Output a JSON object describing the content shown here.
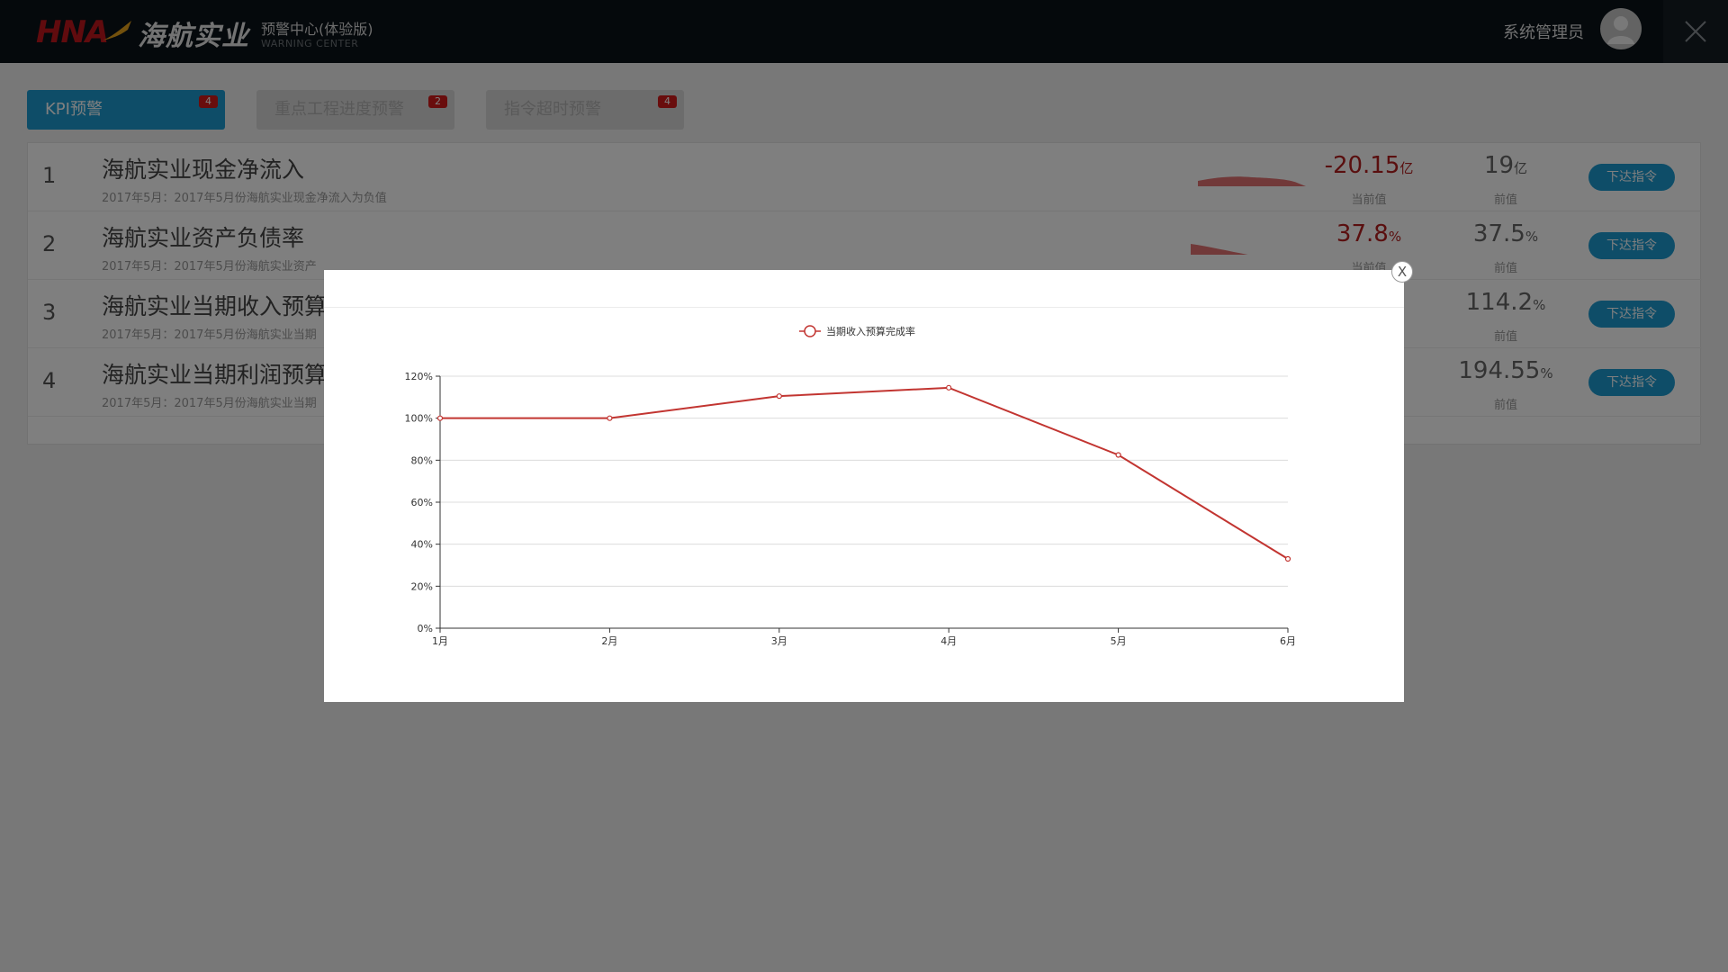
{
  "header": {
    "logo_latin": "HNA",
    "logo_cn": "海航实业",
    "app_title": "预警中心(体验版)",
    "app_subtitle": "WARNING CENTER",
    "user_name": "系统管理员",
    "avatar_icon": "user-avatar-icon",
    "close_icon": "close-x-icon"
  },
  "tabs": [
    {
      "label": "KPI预警",
      "badge": "4",
      "active": true
    },
    {
      "label": "重点工程进度预警",
      "badge": "2",
      "active": false
    },
    {
      "label": "指令超时预警",
      "badge": "4",
      "active": false
    }
  ],
  "kpi_rows": [
    {
      "index": "1",
      "title": "海航实业现金净流入",
      "desc": "2017年5月：2017年5月份海航实业现金净流入为负值",
      "current_value": "-20.15",
      "current_unit": "亿",
      "current_label": "当前值",
      "prev_value": "19",
      "prev_unit": "亿",
      "prev_label": "前值",
      "button": "下达指令"
    },
    {
      "index": "2",
      "title": "海航实业资产负债率",
      "desc": "2017年5月：2017年5月份海航实业资产",
      "current_value": "37.8",
      "current_unit": "%",
      "current_label": "当前值",
      "prev_value": "37.5",
      "prev_unit": "%",
      "prev_label": "前值",
      "button": "下达指令"
    },
    {
      "index": "3",
      "title": "海航实业当期收入预算完",
      "desc": "2017年5月：2017年5月份海航实业当期",
      "current_value": "",
      "current_unit": "%",
      "current_label": "当前值",
      "prev_value": "114.2",
      "prev_unit": "%",
      "prev_label": "前值",
      "button": "下达指令"
    },
    {
      "index": "4",
      "title": "海航实业当期利润预算完",
      "desc": "2017年5月：2017年5月份海航实业当期",
      "current_value": "",
      "current_unit": "%",
      "current_label": "当前值",
      "prev_value": "194.55",
      "prev_unit": "%",
      "prev_label": "前值",
      "button": "下达指令"
    }
  ],
  "modal": {
    "close_label": "X"
  },
  "chart_data": {
    "type": "line",
    "categories": [
      "1月",
      "2月",
      "3月",
      "4月",
      "5月",
      "6月"
    ],
    "series": [
      {
        "name": "当期收入预算完成率",
        "values": [
          100,
          100,
          110.5,
          114.5,
          82.5,
          33
        ],
        "color": "#c23531"
      }
    ],
    "yticks": [
      "0%",
      "20%",
      "40%",
      "60%",
      "80%",
      "100%",
      "120%"
    ],
    "ylim": [
      0,
      120
    ],
    "grid": true,
    "legend_position": "top-center"
  }
}
